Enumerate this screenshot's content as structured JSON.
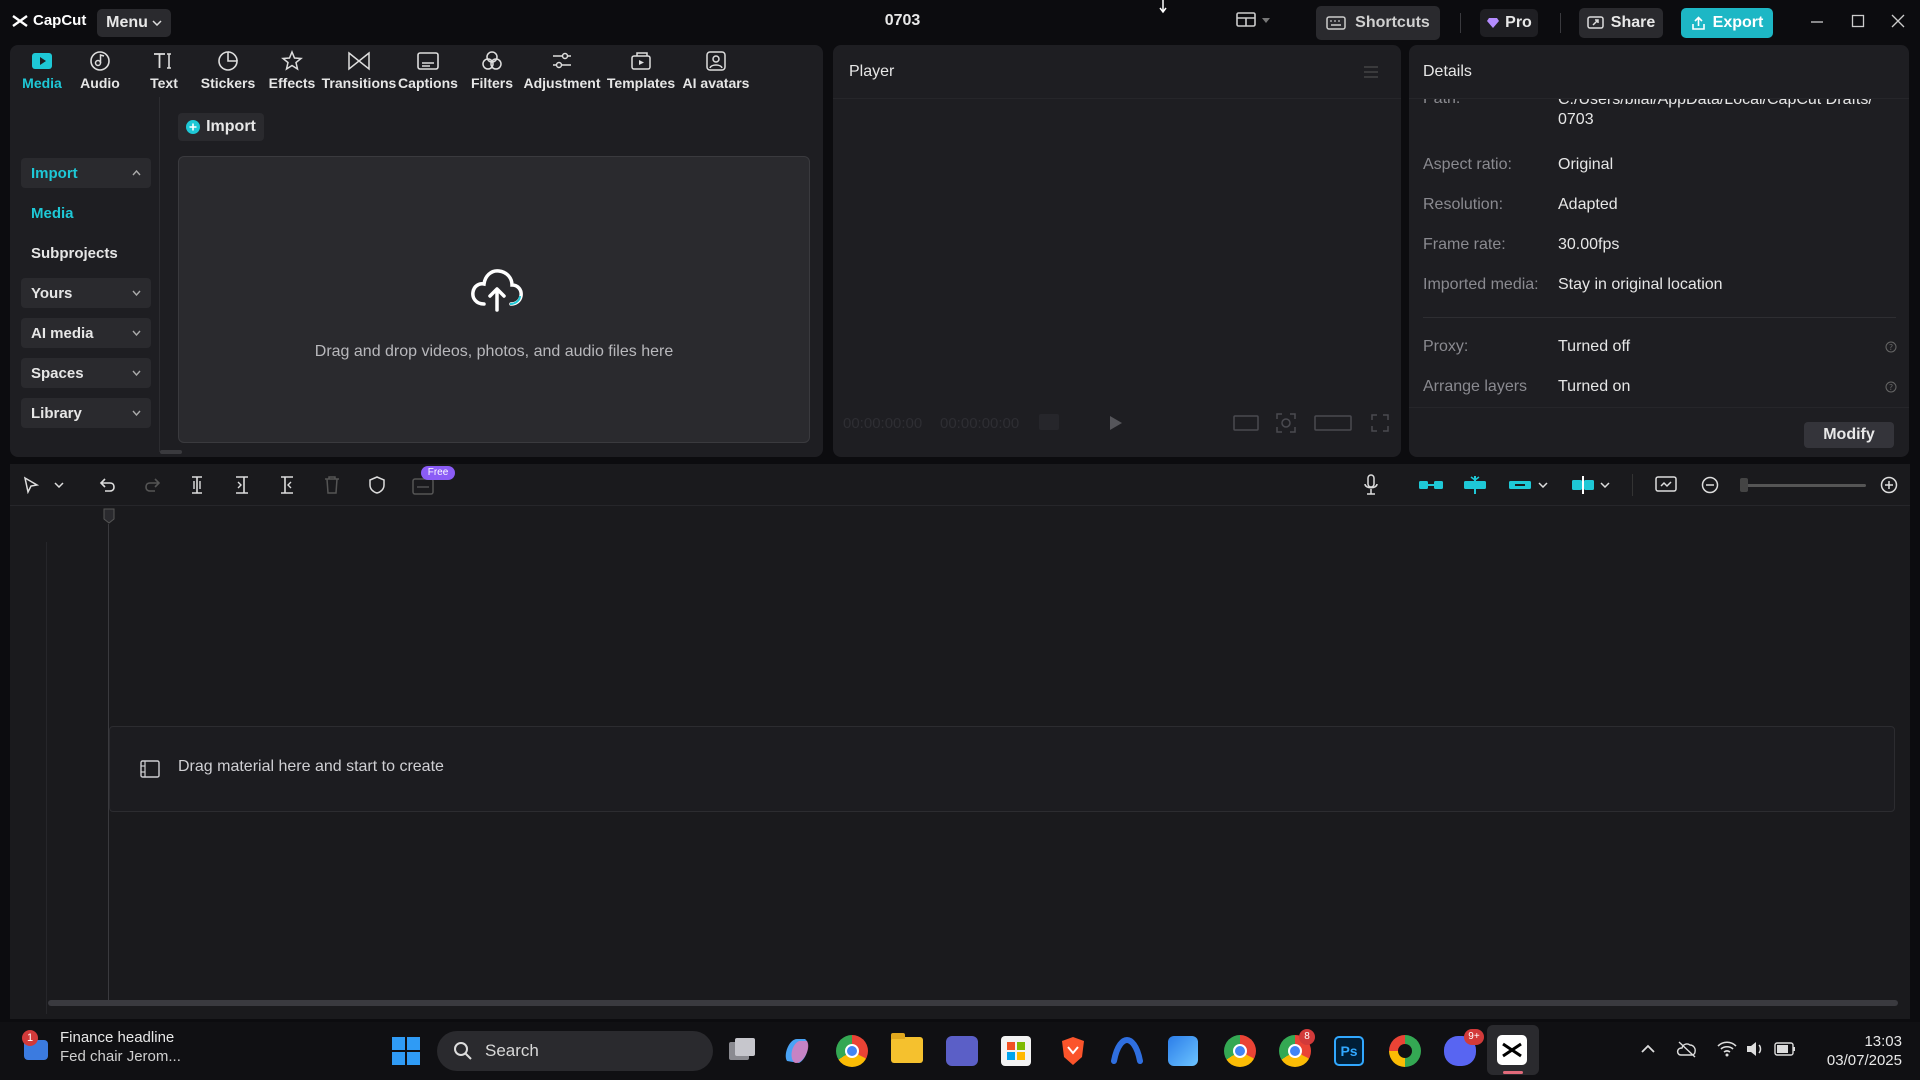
{
  "app": {
    "logo": "CapCut",
    "menu_label": "Menu",
    "project_title": "0703",
    "shortcuts_label": "Shortcuts",
    "pro_label": "Pro",
    "share_label": "Share",
    "export_label": "Export"
  },
  "top_tabs": [
    {
      "label": "Media",
      "icon": "media-icon",
      "active": true
    },
    {
      "label": "Audio",
      "icon": "audio-icon"
    },
    {
      "label": "Text",
      "icon": "text-icon"
    },
    {
      "label": "Stickers",
      "icon": "stickers-icon"
    },
    {
      "label": "Effects",
      "icon": "effects-icon"
    },
    {
      "label": "Transitions",
      "icon": "transitions-icon"
    },
    {
      "label": "Captions",
      "icon": "captions-icon"
    },
    {
      "label": "Filters",
      "icon": "filters-icon"
    },
    {
      "label": "Adjustment",
      "icon": "adjustment-icon"
    },
    {
      "label": "Templates",
      "icon": "templates-icon"
    },
    {
      "label": "AI avatars",
      "icon": "ai-avatars-icon"
    }
  ],
  "sidebar": {
    "items": [
      {
        "label": "Import"
      },
      {
        "label": "Media"
      },
      {
        "label": "Subprojects"
      },
      {
        "label": "Yours"
      },
      {
        "label": "AI media"
      },
      {
        "label": "Spaces"
      },
      {
        "label": "Library"
      }
    ]
  },
  "media": {
    "import_label": "Import",
    "dropzone_text": "Drag and drop videos, photos, and audio files here"
  },
  "player": {
    "title": "Player",
    "current_time": "00:00:00:00",
    "total_time": "00:00:00:00"
  },
  "details": {
    "title": "Details",
    "path_label": "Path:",
    "path_line1": "C:/Users/bilal/AppData/Local/CapCut Drafts/",
    "path_line2": "0703",
    "rows": [
      {
        "key": "Aspect ratio:",
        "value": "Original"
      },
      {
        "key": "Resolution:",
        "value": "Adapted"
      },
      {
        "key": "Frame rate:",
        "value": "30.00fps"
      },
      {
        "key": "Imported media:",
        "value": "Stay in original location"
      },
      {
        "key": "Proxy:",
        "value": "Turned off"
      },
      {
        "key": "Arrange layers",
        "value": "Turned on"
      }
    ],
    "modify_label": "Modify"
  },
  "timeline": {
    "free_badge": "Free",
    "drag_text": "Drag material here and start to create"
  },
  "taskbar": {
    "news_title": "Finance headline",
    "news_sub": "Fed chair Jerom...",
    "news_badge": "1",
    "search_label": "Search",
    "chrome_badge": "8",
    "discord_badge": "9+",
    "time": "13:03",
    "date": "03/07/2025"
  },
  "colors": {
    "accent": "#1ec8d6",
    "export": "#1db7c5",
    "panel": "#1e1e22",
    "background": "#0c0c0f"
  }
}
